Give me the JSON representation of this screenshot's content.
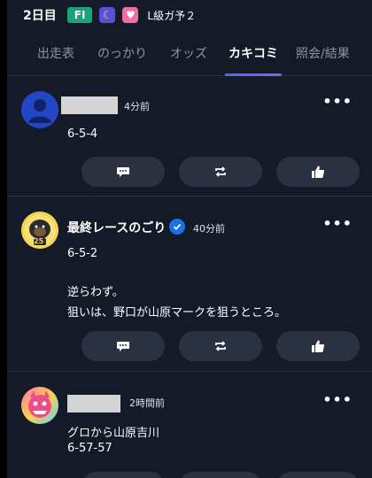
{
  "header": {
    "day": "2日目",
    "grade": "FI",
    "race": "L級ガ予２",
    "icons": [
      "moon-icon",
      "heart-icon"
    ]
  },
  "tabs": [
    {
      "label": "出走表",
      "active": false
    },
    {
      "label": "のっかり",
      "active": false
    },
    {
      "label": "オッズ",
      "active": false
    },
    {
      "label": "カキコミ",
      "active": true
    },
    {
      "label": "照会/結果",
      "active": false
    }
  ],
  "posts": [
    {
      "username": "",
      "time": "4分前",
      "lines": [
        "6-5-4"
      ]
    },
    {
      "username": "最終レースのごり",
      "verified": true,
      "time": "40分前",
      "avatar_text": "25",
      "lines": [
        "6-5-2",
        "",
        "逆らわず。",
        "狙いは、野口が山原マークを狙うところ。"
      ]
    },
    {
      "username": "",
      "time": "2時間前",
      "lines": [
        "グロから山原吉川",
        "6-57-57"
      ]
    }
  ],
  "actions": [
    "comment-icon",
    "repost-icon",
    "like-icon"
  ],
  "colors": {
    "background": "#141a28",
    "grade_badge": "#1aa37a",
    "button": "#2a3140",
    "verified": "#1d6fe8",
    "tab_underline_start": "#4a6cf7",
    "tab_underline_end": "#8b5cf6"
  }
}
